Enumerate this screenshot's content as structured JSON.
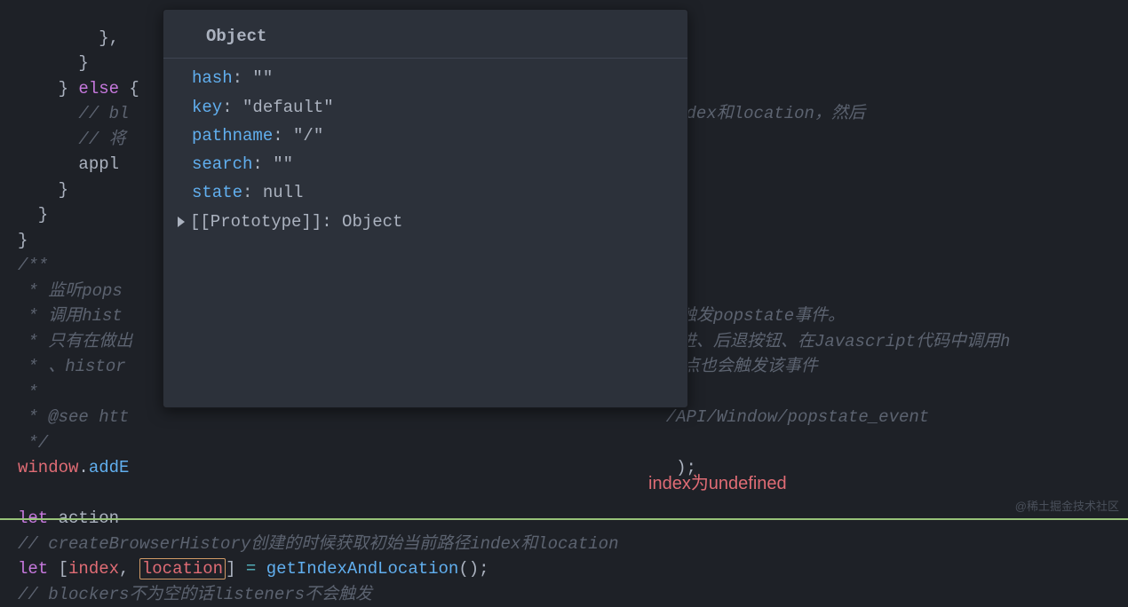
{
  "code": {
    "line1_brace": "        },",
    "line2_brace_close": "      }",
    "line2b_brace": "    } ",
    "line2b_else": "else",
    "line2b_brace_open": " {",
    "line3_comment": "      // bl",
    "line3_comment_tail": "dex和location，然后",
    "line4_comment": "      // 将",
    "line5_apply": "      appl",
    "line6_brace": "    }",
    "line7_brace": "  }",
    "line8_brace": "}",
    "line9_comment": "/**",
    "line10_comment": " * 监听pops",
    "line11_comment": " * 调用hist",
    "line11_comment_tail": "触发popstate事件。",
    "line12_comment": " * 只有在做出",
    "line12_comment_tail": "i进、后退按钮、在Javascript代码中调用h",
    "line13_comment": " * 、histor",
    "line13_comment_tail": "点也会触发该事件",
    "line14_comment": " *",
    "line15_comment": " * @see htt",
    "line15_comment_tail": "/API/Window/popstate_event",
    "line16_comment": " */",
    "line17_window": "window",
    "line17_dot": ".",
    "line17_addE": "addE",
    "line17_tail": ");",
    "line18_blank": "",
    "line19_let": "let",
    "line19_action": " action ",
    "line20_comment": "// createBrowserHistory创建的时候获取初始当前路径index和location",
    "line21_let": "let",
    "line21_bracket_open": " [",
    "line21_index": "index",
    "line21_comma": ", ",
    "line21_location": "location",
    "line21_bracket_close": "] ",
    "line21_eq": "=",
    "line21_space": " ",
    "line21_fn": "getIndexAndLocation",
    "line21_paren": "();",
    "line22_comment": "// blockers不为空的话listeners不会触发"
  },
  "tooltip": {
    "header": "Object",
    "hash_key": "hash",
    "hash_val": "\"\"",
    "key_key": "key",
    "key_val": "\"default\"",
    "pathname_key": "pathname",
    "pathname_val": "\"/\"",
    "search_key": "search",
    "search_val": "\"\"",
    "state_key": "state",
    "state_val": "null",
    "proto_label": "[[Prototype]]:",
    "proto_val": "Object"
  },
  "annotation": {
    "text": "index为undefined"
  },
  "watermark": "@稀土掘金技术社区"
}
